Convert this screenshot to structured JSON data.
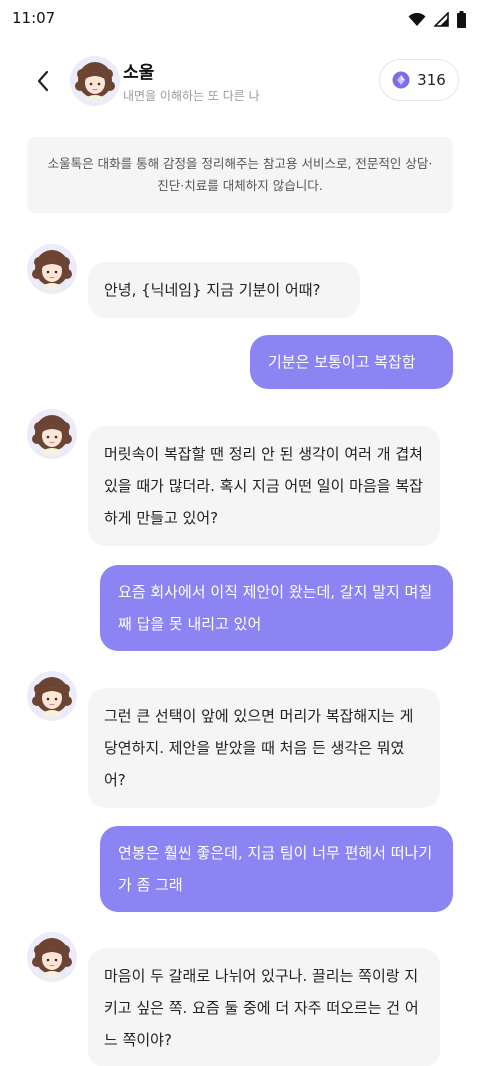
{
  "status": {
    "time": "11:07"
  },
  "header": {
    "name": "소울",
    "subtitle": "내면을 이해하는 또 다른 나",
    "points": "316"
  },
  "notice": "소울톡은 대화를 통해 감정을 정리해주는 참고용 서비스로, 전문적인 상담·진단·치료를 대체하지 않습니다.",
  "messages": [
    {
      "from": "bot",
      "text": "안녕, {닉네임} 지금 기분이 어때?"
    },
    {
      "from": "user",
      "text": "기분은 보통이고 복잡함"
    },
    {
      "from": "bot",
      "text": "머릿속이 복잡할 땐 정리 안 된 생각이 여러 개 겹쳐 있을 때가 많더라. 혹시 지금 어떤 일이 마음을 복잡하게 만들고 있어?"
    },
    {
      "from": "user",
      "text": "요즘 회사에서 이직 제안이 왔는데, 갈지 말지 며칠째 답을 못 내리고 있어"
    },
    {
      "from": "bot",
      "text": "그런 큰 선택이 앞에 있으면 머리가 복잡해지는 게 당연하지. 제안을 받았을 때 처음 든 생각은 뭐였어?"
    },
    {
      "from": "user",
      "text": "연봉은 훨씬 좋은데, 지금 팀이 너무 편해서 떠나기가 좀 그래"
    },
    {
      "from": "bot",
      "text": "마음이 두 갈래로 나뉘어 있구나. 끌리는 쪽이랑 지키고 싶은 쪽. 요즘 둘 중에 더 자주 떠오르는 건 어느 쪽이야?"
    }
  ],
  "colors": {
    "user_bubble": "#8c84f3",
    "bot_bubble": "#f5f5f5",
    "points_gem": "#7a6fe6"
  }
}
